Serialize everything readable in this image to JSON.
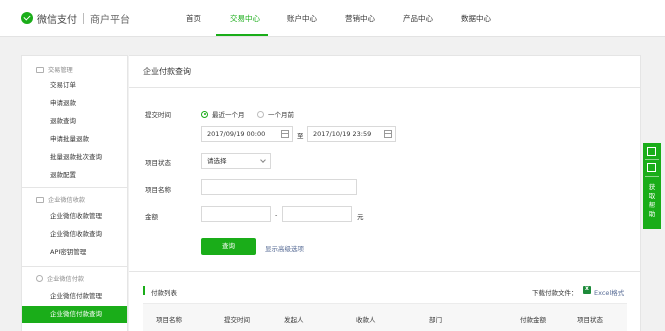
{
  "brand": {
    "name": "微信支付",
    "sub": "商户平台"
  },
  "nav": [
    "首页",
    "交易中心",
    "账户中心",
    "营销中心",
    "产品中心",
    "数据中心"
  ],
  "sidebar": {
    "groups": [
      {
        "title": "交易管理",
        "items": [
          "交易订单",
          "申请退款",
          "退款查询",
          "申请批量退款",
          "批量退款批次查询",
          "退款配置"
        ]
      },
      {
        "title": "企业微信收款",
        "items": [
          "企业微信收款管理",
          "企业微信收款查询",
          "API密钥管理"
        ]
      },
      {
        "title": "企业微信付款",
        "items": [
          "企业微信付款管理",
          "企业微信付款查询"
        ]
      }
    ]
  },
  "page_title": "企业付款查询",
  "form": {
    "time_label": "提交时间",
    "radio_recent": "最近一个月",
    "radio_earlier": "一个月前",
    "start_date": "2017/09/19 00:00",
    "to_text": "至",
    "end_date": "2017/10/19 23:59",
    "status_label": "项目状态",
    "status_value": "请选择",
    "name_label": "项目名称",
    "name_value": "",
    "amount_label": "金额",
    "amount_from": "",
    "amount_dash": "-",
    "amount_to": "",
    "amount_unit": "元",
    "query_button": "查询",
    "advanced_link": "显示高级选项"
  },
  "list": {
    "title": "付款列表",
    "download_label": "下载付款文件：",
    "excel_link": "Excel格式",
    "columns": [
      "项目名称",
      "提交时间",
      "发起人",
      "收款人",
      "部门",
      "付款金额",
      "项目状态"
    ]
  },
  "float_panel": {
    "label": "获取帮助"
  },
  "colors": {
    "accent": "#1aad19",
    "link": "#576b95"
  }
}
